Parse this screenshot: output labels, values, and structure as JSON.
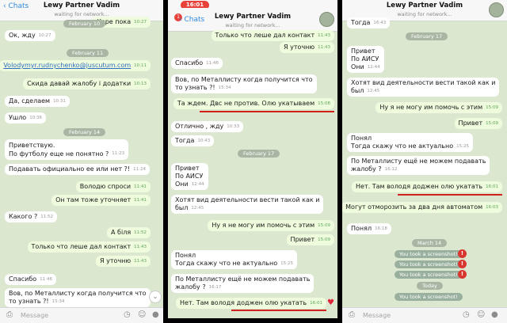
{
  "left": {
    "back": "Chats",
    "title": "Lewy Partner Vadim",
    "subtitle": "waiting for network...",
    "messages": [
      {
        "text": "Харе пока",
        "time": "10:27",
        "out": true
      },
      {
        "text": "Ок, жду",
        "time": "10:27",
        "out": false
      },
      {
        "text": "Volodymyr.rudnychenko@juscutum.com",
        "time": "10:11",
        "out": true,
        "link": true
      },
      {
        "text": "Скида давай жалобу і додатки",
        "time": "10:13",
        "out": true
      },
      {
        "text": "Да, сделаем",
        "time": "10:31",
        "out": false
      },
      {
        "text": "Ушло",
        "time": "10:36",
        "out": false
      },
      {
        "text": "Приветствую.",
        "time": "",
        "out": false
      },
      {
        "text": "По футболу еще не понятно ?",
        "time": "11:23",
        "out": false
      },
      {
        "text": "Подавать официально ее или нет ?!",
        "time": "11:24",
        "out": false
      },
      {
        "text": "Володю спроси",
        "time": "11:41",
        "out": true
      },
      {
        "text": "Он там тоже уточняет",
        "time": "11:41",
        "out": true
      },
      {
        "text": "Какого ?",
        "time": "11:52",
        "out": false
      },
      {
        "text": "А біля",
        "time": "11:52",
        "out": true
      },
      {
        "text": "Только что леше дал контакт",
        "time": "11:43",
        "out": true
      },
      {
        "text": "Я уточню",
        "time": "11:43",
        "out": true
      },
      {
        "text": "Спасибо",
        "time": "11:46",
        "out": false
      },
      {
        "text": "Вов, по Металлисту когда получится что",
        "time": "",
        "out": false
      },
      {
        "text": "то узнать ?!",
        "time": "15:34",
        "out": false
      }
    ],
    "dates": [
      "February 10",
      "February 11",
      "February 14"
    ],
    "input_placeholder": "Message"
  },
  "middle": {
    "clock": "16:01",
    "back": "Chats",
    "badge": "1",
    "title": "Lewy Partner Vadim",
    "subtitle": "waiting for network...",
    "messages": [
      {
        "text": "Только что леше дал контакт",
        "time": "11:43",
        "out": true
      },
      {
        "text": "Я уточню",
        "time": "11:43",
        "out": true
      },
      {
        "text": "Спасибо",
        "time": "11:46",
        "out": false
      },
      {
        "text": "Вов, по Металлисту когда получится что",
        "time": "",
        "out": false
      },
      {
        "text": "то узнать ?!",
        "time": "15:34",
        "out": false
      },
      {
        "text": "Та ждем. Двс не против. Олю укатываем",
        "time": "15:08",
        "out": true
      },
      {
        "text": "Отлично , жду",
        "time": "10:33",
        "out": false
      },
      {
        "text": "Тогда",
        "time": "10:43",
        "out": false
      },
      {
        "text": "Привет",
        "time": "",
        "out": false
      },
      {
        "text": "По АИСУ",
        "time": "",
        "out": false
      },
      {
        "text": "Они",
        "time": "12:44",
        "out": false
      },
      {
        "text": "Хотят вид деятельности вести такой как и",
        "time": "",
        "out": false
      },
      {
        "text": "был",
        "time": "12:45",
        "out": false
      },
      {
        "text": "Ну я не могу им помочь с этим",
        "time": "15:09",
        "out": true
      },
      {
        "text": "Привет",
        "time": "15:09",
        "out": true
      },
      {
        "text": "Понял",
        "time": "",
        "out": false
      },
      {
        "text": "Тогда скажу что не актуально",
        "time": "15:25",
        "out": false
      },
      {
        "text": "По Металлисту ещё не можем подавать",
        "time": "",
        "out": false
      },
      {
        "text": "жалобу ?",
        "time": "16:17",
        "out": false
      },
      {
        "text": "Нет. Там володя доджен олю укатать",
        "time": "16:01",
        "out": true
      }
    ],
    "dates": [
      "February 17"
    ]
  },
  "right": {
    "title": "Lewy Partner Vadim",
    "subtitle": "waiting for network...",
    "messages": [
      {
        "text": "Тогда",
        "time": "16:43",
        "out": false
      },
      {
        "text": "Привет",
        "time": "",
        "out": false
      },
      {
        "text": "По АИСУ",
        "time": "",
        "out": false
      },
      {
        "text": "Они",
        "time": "12:44",
        "out": false
      },
      {
        "text": "Хотят вид деятельности вести такой как и",
        "time": "",
        "out": false
      },
      {
        "text": "был",
        "time": "12:45",
        "out": false
      },
      {
        "text": "Ну я не могу им помочь с этим",
        "time": "15:09",
        "out": true
      },
      {
        "text": "Привет",
        "time": "15:09",
        "out": true
      },
      {
        "text": "Понял",
        "time": "",
        "out": false
      },
      {
        "text": "Тогда скажу что не актуально",
        "time": "15:25",
        "out": false
      },
      {
        "text": "По Металлисту ещё не можем подавать",
        "time": "",
        "out": false
      },
      {
        "text": "жалобу ?",
        "time": "16:12",
        "out": false
      },
      {
        "text": "Нет. Там володя доджен олю укатать",
        "time": "16:01",
        "out": true
      },
      {
        "text": "Могут отморозить за два дня автоматом",
        "time": "16:03",
        "out": true
      },
      {
        "text": "Понял",
        "time": "16:18",
        "out": false
      }
    ],
    "dates": [
      "February 17",
      "March 14",
      "Today"
    ],
    "screenshots": [
      "You took a screenshot!",
      "You took a screenshot!",
      "You took a screenshot!",
      "You took a screenshot!"
    ],
    "input_placeholder": "Message"
  }
}
